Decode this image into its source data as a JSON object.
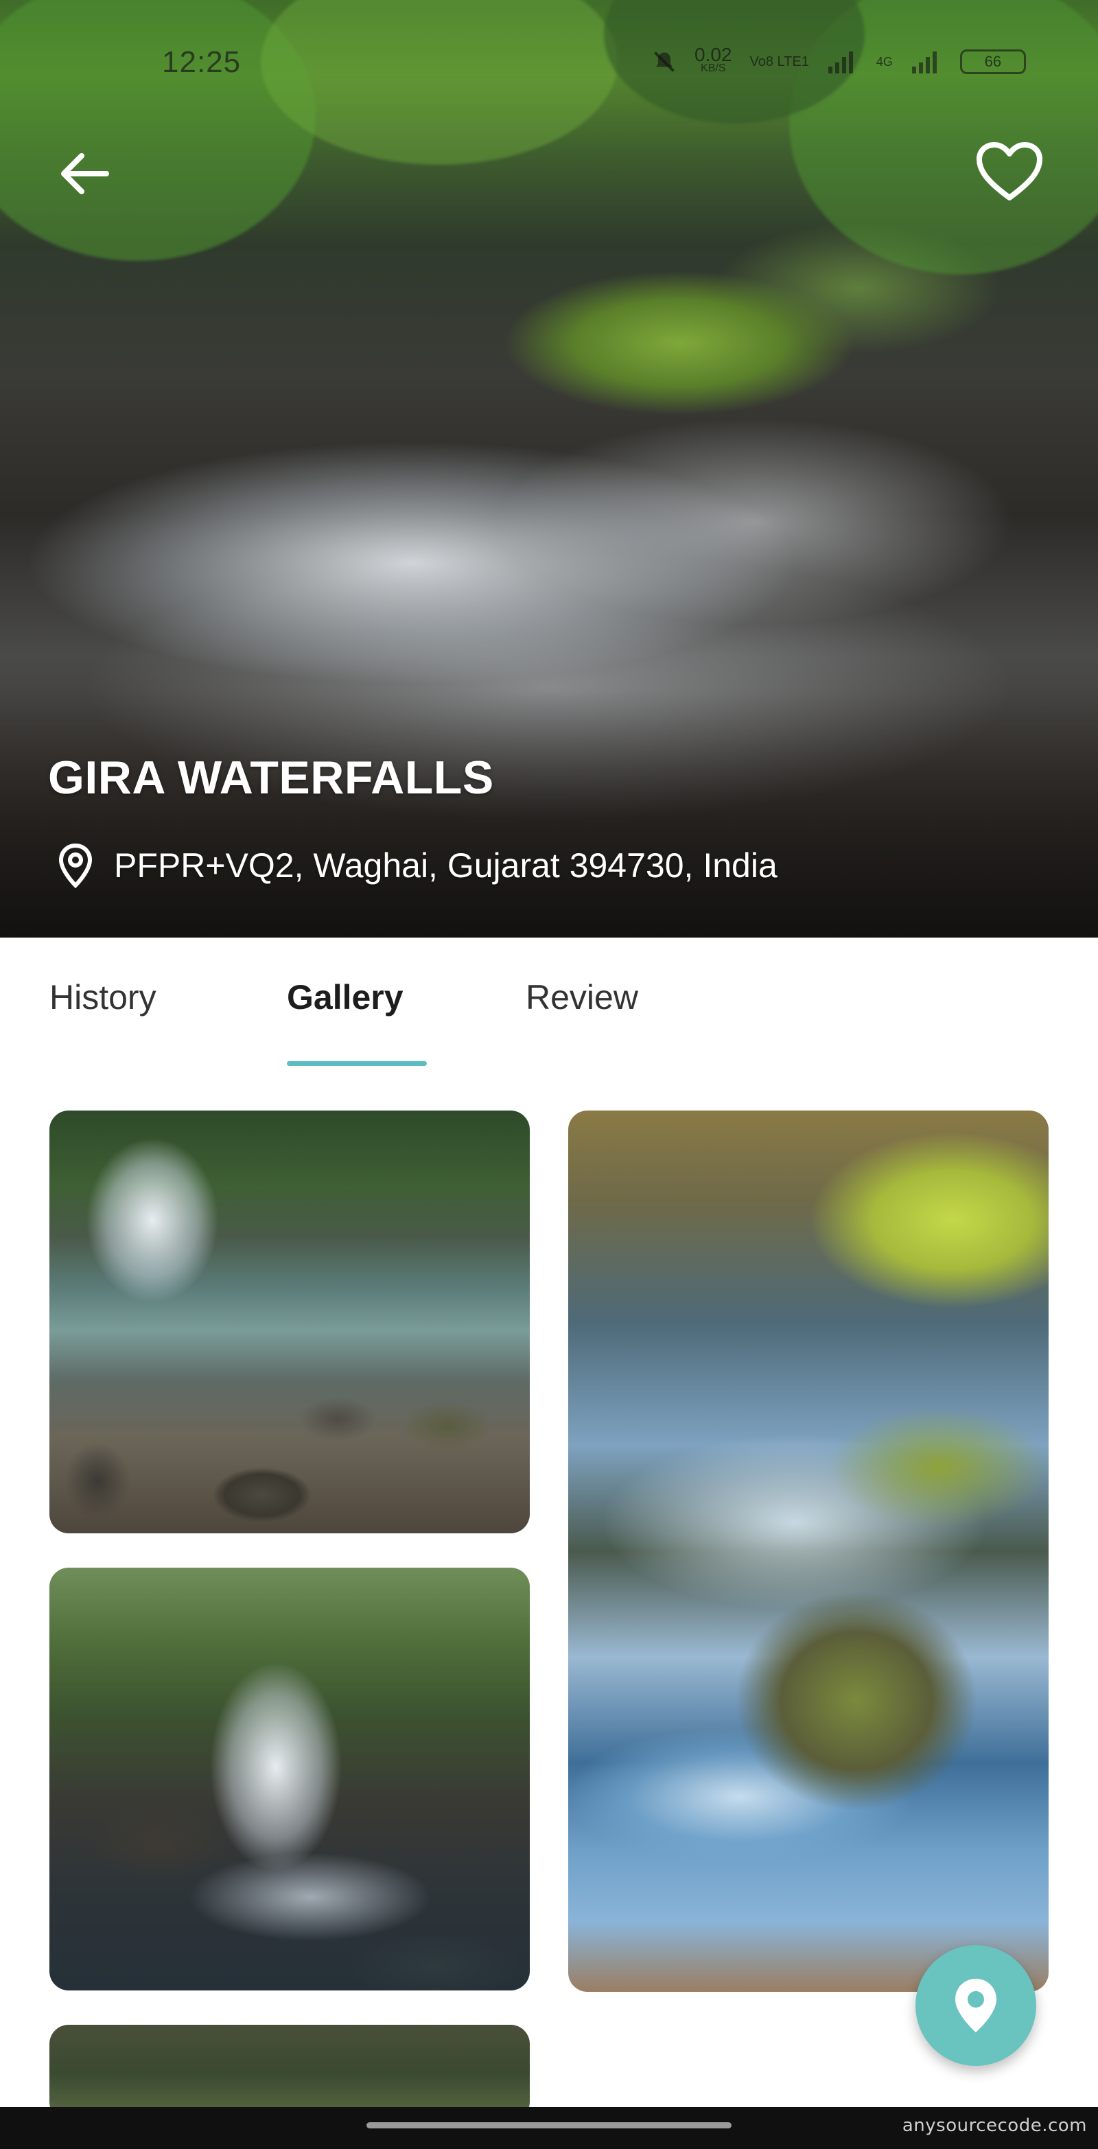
{
  "status_bar": {
    "time": "12:25",
    "network_speed": "0.02",
    "network_unit": "KB/S",
    "network_type": "Vo8 LTE1",
    "signal_label": "4G",
    "battery": "66"
  },
  "hero": {
    "title": "GIRA WATERFALLS",
    "address": "PFPR+VQ2, Waghai, Gujarat 394730, India"
  },
  "tabs": [
    {
      "label": "History",
      "active": false
    },
    {
      "label": "Gallery",
      "active": true
    },
    {
      "label": "Review",
      "active": false
    }
  ],
  "gallery": {
    "images": [
      "waterfall-pool-photo",
      "mossy-stream-photo",
      "forest-cascade-photo",
      "forest-photo"
    ]
  },
  "colors": {
    "accent": "#5fbcc0",
    "fab": "#69c3bf"
  },
  "icons": {
    "back": "arrow-left-icon",
    "favorite": "heart-outline-icon",
    "location": "map-pin-icon",
    "fab": "map-pin-icon"
  },
  "footer": {
    "watermark": "anysourcecode.com"
  }
}
